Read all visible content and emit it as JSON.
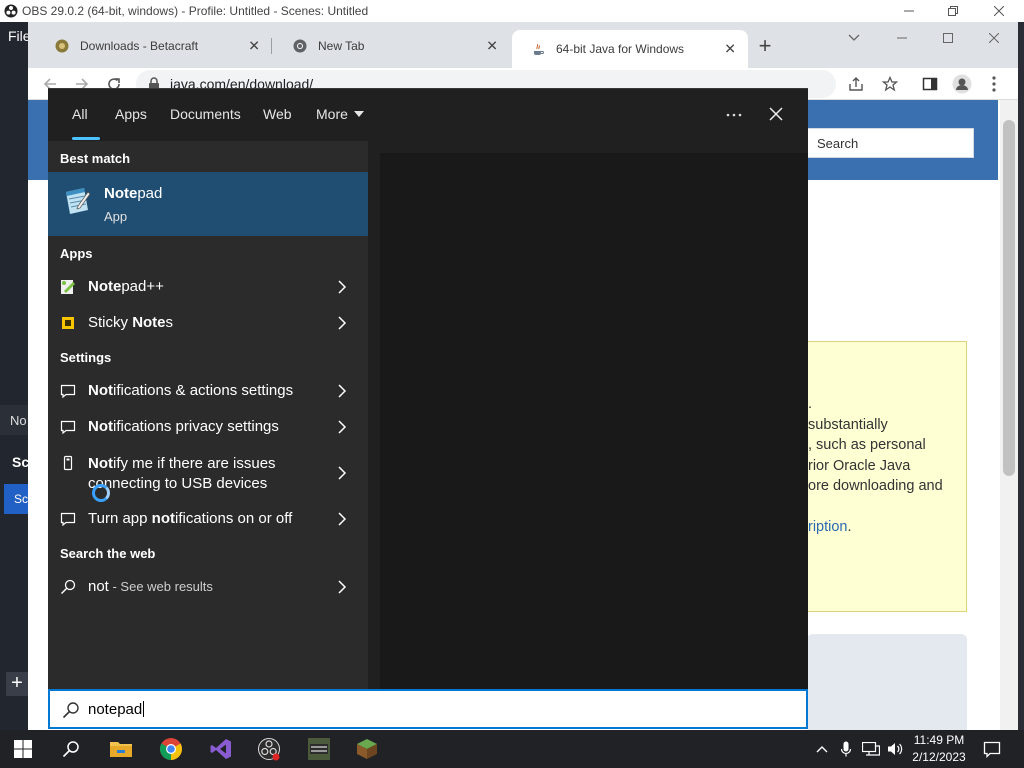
{
  "obs": {
    "title": "OBS 29.0.2 (64-bit, windows) - Profile: Untitled - Scenes: Untitled",
    "menu_file": "File",
    "sources_label": "No",
    "scenes_header": "Sc",
    "scene_item": "Sc"
  },
  "chrome": {
    "tabs": [
      {
        "label": "Downloads - Betacraft",
        "icon": "betacraft-favicon"
      },
      {
        "label": "New Tab",
        "icon": "chrome-favicon"
      },
      {
        "label": "64-bit Java for Windows",
        "icon": "java-favicon"
      }
    ],
    "url": "java.com/en/download/",
    "page": {
      "search_placeholder": "Search",
      "notice_lines": [
        ".",
        "substantially",
        ", such as personal",
        "rior Oracle Java",
        "ore downloading and"
      ],
      "notice_link": "ription",
      "notice_link_suffix": "."
    }
  },
  "search": {
    "filters": [
      "All",
      "Apps",
      "Documents",
      "Web",
      "More"
    ],
    "active_filter": "All",
    "best_match_header": "Best match",
    "best_match": {
      "name_bold": "Note",
      "name_rest": "pad",
      "kind": "App"
    },
    "apps_header": "Apps",
    "apps": [
      {
        "bold": "Note",
        "rest": "pad++",
        "icon": "notepad-plus-plus-icon"
      },
      {
        "pre": "Sticky ",
        "bold": "Note",
        "rest": "s",
        "icon": "sticky-notes-icon"
      }
    ],
    "settings_header": "Settings",
    "settings": [
      {
        "bold": "Not",
        "rest": "ifications & actions settings"
      },
      {
        "bold": "Not",
        "rest": "ifications privacy settings"
      },
      {
        "bold": "Not",
        "rest": "ify me if there are issues",
        "line2": "connecting to USB devices"
      },
      {
        "pre": "Turn app ",
        "bold": "not",
        "rest": "ifications on or off"
      }
    ],
    "web_header": "Search the web",
    "web_query": "not",
    "web_suffix": " - See web results",
    "query": "notepad"
  },
  "taskbar": {
    "time": "11:49 PM",
    "date": "2/12/2023"
  },
  "colors": {
    "accent": "#4cc2ff",
    "best_match_bg": "#1f4e72",
    "panel_bg": "#202020",
    "results_bg": "#2b2b2b"
  }
}
